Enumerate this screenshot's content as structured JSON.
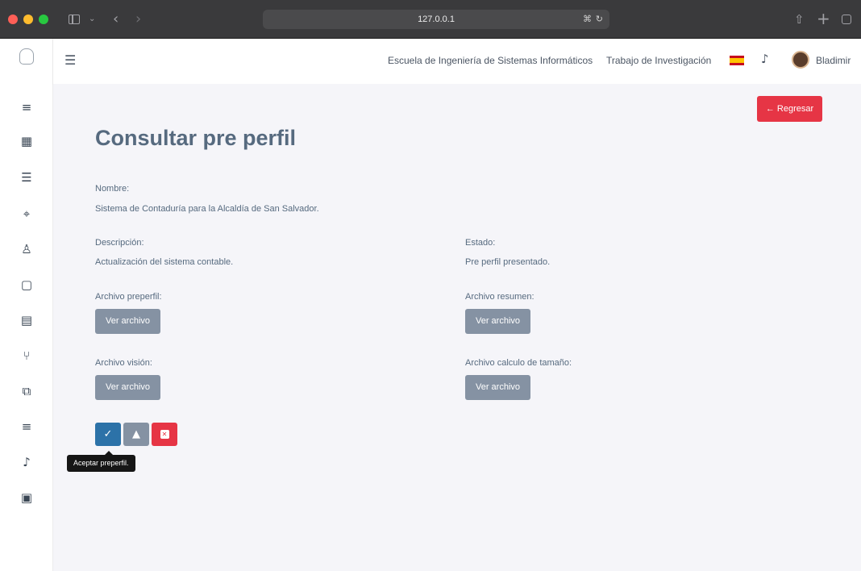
{
  "browser": {
    "url": "127.0.0.1"
  },
  "topbar": {
    "school": "Escuela de Ingeniería de Sistemas Informáticos",
    "research": "Trabajo de Investigación",
    "user": "Bladimir"
  },
  "page": {
    "back_button": "← Regresar",
    "title": "Consultar pre perfil"
  },
  "profile": {
    "name_label": "Nombre:",
    "name_value": "Sistema de Contaduría para la Alcaldía de San Salvador.",
    "description_label": "Descripción:",
    "description_value": "Actualización del sistema contable.",
    "state_label": "Estado:",
    "state_value": "Pre perfil presentado.",
    "preprofile_file_label": "Archivo preperfil:",
    "summary_file_label": "Archivo resumen:",
    "vision_file_label": "Archivo visión:",
    "size_file_label": "Archivo calculo de tamaño:",
    "view_file_button": "Ver archivo"
  },
  "actions": {
    "accept_icon": "✓",
    "observe_icon": "▲",
    "reject_icon": "✕",
    "tooltip": "Aceptar preperfil."
  },
  "sidebar_icons": [
    "user-list-icon",
    "building-icon",
    "layers-icon",
    "target-icon",
    "users-icon",
    "file-icon",
    "document-icon",
    "git-pull-request-icon",
    "code-icon",
    "user-list-icon",
    "bell-icon",
    "calendar-icon"
  ]
}
